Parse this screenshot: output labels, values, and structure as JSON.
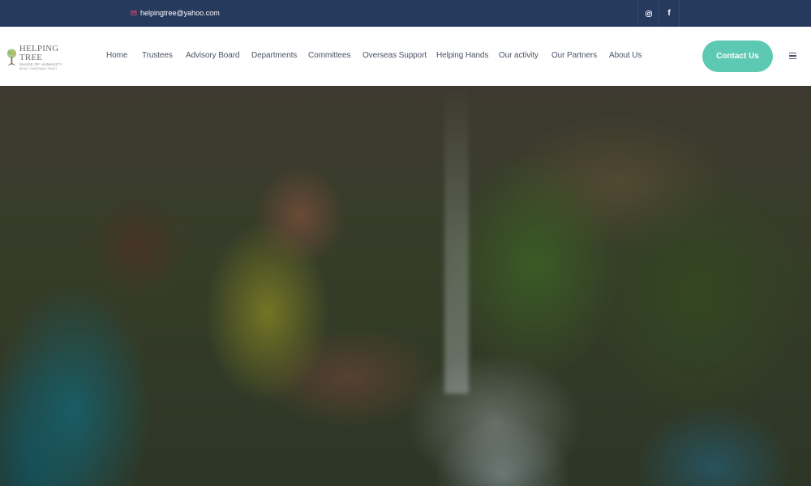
{
  "topbar": {
    "email": "helpingtree@yahoo.com",
    "email_icon": "mail-icon",
    "social": [
      {
        "name": "instagram-icon",
        "glyph": "◎"
      },
      {
        "name": "facebook-icon",
        "glyph": "f"
      }
    ]
  },
  "header": {
    "logo": {
      "brand": "HELPING TREE",
      "tagline": "SHADE OF HUMANITY",
      "subtag": "REGD. CHARITABLE TRUST"
    },
    "nav": {
      "home": "Home",
      "trustees": "Trustees",
      "advisory_board": "Advisory Board",
      "departments": "Departments",
      "committees": "Committees",
      "overseas_support": "Overseas Support",
      "helping_hands": "Helping Hands",
      "our_activity": "Our activity",
      "our_partners": "Our Partners",
      "about_us": "About Us"
    },
    "contact_label": "Contact Us",
    "menu_icon": "hamburger-icon"
  },
  "colors": {
    "topbar": "#263a5e",
    "accent": "#5ec9b2",
    "nav_text": "#4a5568",
    "email_icon": "#e0445a"
  }
}
